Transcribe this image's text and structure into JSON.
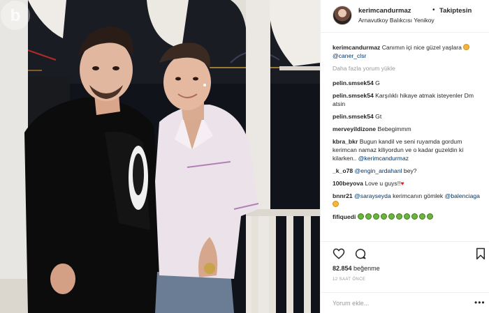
{
  "post": {
    "username": "kerimcandurmaz",
    "separator": "•",
    "follow_status": "Takiptesin",
    "location": "Arnavutkoy Balıkcısı Yenikoy"
  },
  "caption": {
    "username": "kerimcandurmaz",
    "text": "Canımın içi nice güzel yaşlara",
    "mention": "@caner_clsr"
  },
  "load_more": "Daha fazla yorum yükle",
  "comments": [
    {
      "user": "pelin.smsek54",
      "text": "G",
      "mention": ""
    },
    {
      "user": "pelin.smsek54",
      "text": "Karşılıklı hikaye atmak isteyenler Dm atsin",
      "mention": ""
    },
    {
      "user": "pelin.smsek54",
      "text": "Gt",
      "mention": ""
    },
    {
      "user": "merveyildizone",
      "text": "Bebegimmm",
      "mention": ""
    },
    {
      "user": "kbra_bkr",
      "text": "Bugun kandil ve seni ruyamda gordum kerimcan namaz kiliyordun ve o kadar guzeldin ki kilarken..",
      "mention": "@kerimcandurmaz"
    },
    {
      "user": "_k_o78",
      "text": "bey?",
      "mention": "@engin_ardahanl"
    },
    {
      "user": "100beyova",
      "text": "Love u guys!!",
      "mention": ""
    },
    {
      "user": "bnnr21",
      "text": "kerimcanın gömlek",
      "mention": "@sarayseyda",
      "mention2": "@balenciaga"
    },
    {
      "user": "fifiquedi",
      "text": "",
      "mention": ""
    }
  ],
  "actions": {
    "like_icon": "heart-outline-icon",
    "comment_icon": "comment-bubble-icon",
    "save_icon": "bookmark-icon"
  },
  "likes": {
    "count": "82.854",
    "label": "beğenme"
  },
  "time_ago": "12 SAAT ÖNCE",
  "add_comment": {
    "placeholder": "Yorum ekle..."
  },
  "colors": {
    "text": "#262626",
    "secondary": "#999999",
    "mention": "#003569",
    "border": "#efefef"
  }
}
